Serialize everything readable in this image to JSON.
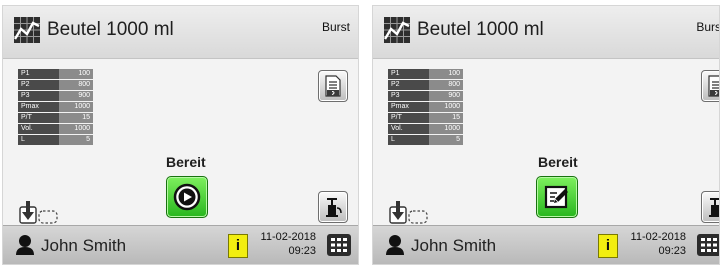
{
  "screens": [
    {
      "program_title": "Beutel 1000 ml",
      "mode": "Burst",
      "parameters": [
        {
          "key": "P1",
          "value": "100"
        },
        {
          "key": "P2",
          "value": "800"
        },
        {
          "key": "P3",
          "value": "900"
        },
        {
          "key": "Pmax",
          "value": "1000"
        },
        {
          "key": "P/T",
          "value": "15"
        },
        {
          "key": "Vol.",
          "value": "1000"
        },
        {
          "key": "L",
          "value": "5"
        }
      ],
      "status": "Bereit",
      "action_icon": "play-icon",
      "user_name": "John Smith",
      "info_label": "i",
      "date": "11-02-2018",
      "time": "09:23"
    },
    {
      "program_title": "Beutel 1000 ml",
      "mode": "Burs",
      "parameters": [
        {
          "key": "P1",
          "value": "100"
        },
        {
          "key": "P2",
          "value": "800"
        },
        {
          "key": "P3",
          "value": "900"
        },
        {
          "key": "Pmax",
          "value": "1000"
        },
        {
          "key": "P/T",
          "value": "15"
        },
        {
          "key": "Vol.",
          "value": "1000"
        },
        {
          "key": "L",
          "value": "5"
        }
      ],
      "status": "Bereit",
      "action_icon": "edit-icon",
      "user_name": "John Smith",
      "info_label": "i",
      "date": "11-02-2018",
      "time": "09:23"
    }
  ],
  "colors": {
    "action_green": "#27b61d",
    "info_yellow": "#f2ee10",
    "table_key": "#4a4a4a",
    "table_value": "#8b8b8b"
  }
}
